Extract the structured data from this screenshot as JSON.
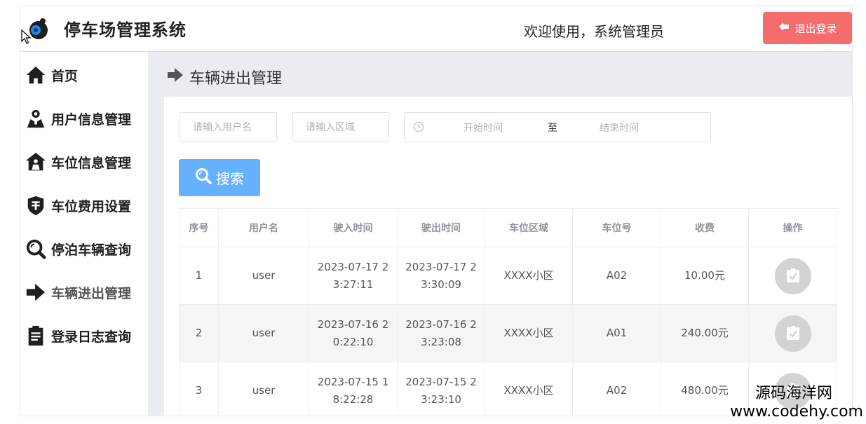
{
  "header": {
    "app_title": "停车场管理系统",
    "welcome": "欢迎使用，系统管理员",
    "logout_label": "退出登录"
  },
  "sidebar": {
    "items": [
      {
        "label": "首页",
        "icon": "home-icon"
      },
      {
        "label": "用户信息管理",
        "icon": "user-icon"
      },
      {
        "label": "车位信息管理",
        "icon": "building-icon"
      },
      {
        "label": "车位费用设置",
        "icon": "shield-money-icon"
      },
      {
        "label": "停泊车辆查询",
        "icon": "search-icon"
      },
      {
        "label": "车辆进出管理",
        "icon": "arrow-right-icon"
      },
      {
        "label": "登录日志查询",
        "icon": "clipboard-icon"
      }
    ],
    "active_index": 5
  },
  "page": {
    "title": "车辆进出管理"
  },
  "filters": {
    "username_placeholder": "请输入用户名",
    "area_placeholder": "请输入区域",
    "start_placeholder": "开始时间",
    "range_separator": "至",
    "end_placeholder": "结束时间",
    "search_label": "搜索"
  },
  "table": {
    "columns": [
      "序号",
      "用户名",
      "驶入时间",
      "驶出时间",
      "车位区域",
      "车位号",
      "收费",
      "操作"
    ],
    "rows": [
      {
        "index": "1",
        "username": "user",
        "in_time": "2023-07-17 23:27:11",
        "out_time": "2023-07-17 23:30:09",
        "area": "XXXX小区",
        "space": "A02",
        "fee": "10.00元"
      },
      {
        "index": "2",
        "username": "user",
        "in_time": "2023-07-16 20:22:10",
        "out_time": "2023-07-16 23:23:08",
        "area": "XXXX小区",
        "space": "A01",
        "fee": "240.00元"
      },
      {
        "index": "3",
        "username": "user",
        "in_time": "2023-07-15 18:22:28",
        "out_time": "2023-07-15 23:23:10",
        "area": "XXXX小区",
        "space": "A02",
        "fee": "480.00元"
      }
    ]
  },
  "watermark": {
    "line1": "源码海洋网",
    "line2": "www.codehy.com"
  },
  "colors": {
    "logout_bg": "#f56c6c",
    "search_bg": "#66b1ff",
    "main_bg": "#e9edf1",
    "action_bg": "#d3d3d3"
  }
}
